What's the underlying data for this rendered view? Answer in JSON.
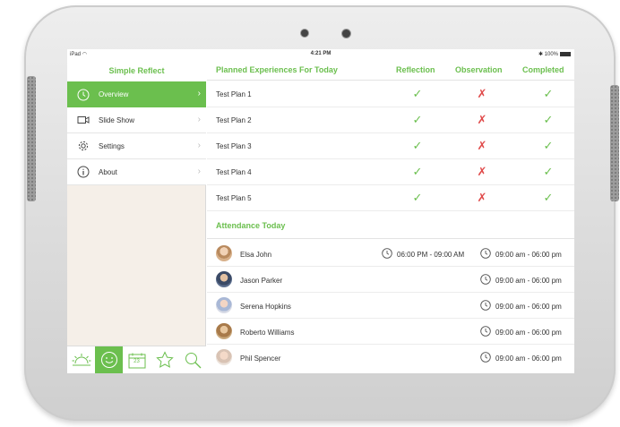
{
  "status": {
    "carrier": "iPad",
    "time": "4:21 PM",
    "battery": "100%"
  },
  "sidebar": {
    "title": "Simple Reflect",
    "items": [
      {
        "label": "Overview",
        "icon": "clock-icon",
        "active": true
      },
      {
        "label": "Slide Show",
        "icon": "video-camera-icon",
        "active": false
      },
      {
        "label": "Settings",
        "icon": "gear-icon",
        "active": false
      },
      {
        "label": "About",
        "icon": "info-icon",
        "active": false
      }
    ],
    "tabs": [
      "sun-icon",
      "smiley-icon",
      "calendar-icon",
      "star-icon",
      "search-icon"
    ],
    "calendar_day": "23"
  },
  "plans": {
    "title": "Planned Experiences For Today",
    "columns": [
      "Reflection",
      "Observation",
      "Completed"
    ],
    "rows": [
      {
        "name": "Test Plan 1",
        "reflection": true,
        "observation": false,
        "completed": true
      },
      {
        "name": "Test Plan 2",
        "reflection": true,
        "observation": false,
        "completed": true
      },
      {
        "name": "Test Plan 3",
        "reflection": true,
        "observation": false,
        "completed": true
      },
      {
        "name": "Test Plan 4",
        "reflection": true,
        "observation": false,
        "completed": true
      },
      {
        "name": "Test Plan 5",
        "reflection": true,
        "observation": false,
        "completed": true
      }
    ]
  },
  "attendance": {
    "title": "Attendance Today",
    "rows": [
      {
        "name": "Elsa John",
        "time1": "06:00 PM - 09:00 AM",
        "time2": "09:00 am - 06:00 pm"
      },
      {
        "name": "Jason Parker",
        "time1": "",
        "time2": "09:00 am - 06:00 pm"
      },
      {
        "name": "Serena Hopkins",
        "time1": "",
        "time2": "09:00 am - 06:00 pm"
      },
      {
        "name": "Roberto Williams",
        "time1": "",
        "time2": "09:00 am - 06:00 pm"
      },
      {
        "name": "Phil Spencer",
        "time1": "",
        "time2": "09:00 am - 06:00 pm"
      }
    ]
  },
  "colors": {
    "accent": "#6bbf4e",
    "cross": "#e04b4b"
  }
}
